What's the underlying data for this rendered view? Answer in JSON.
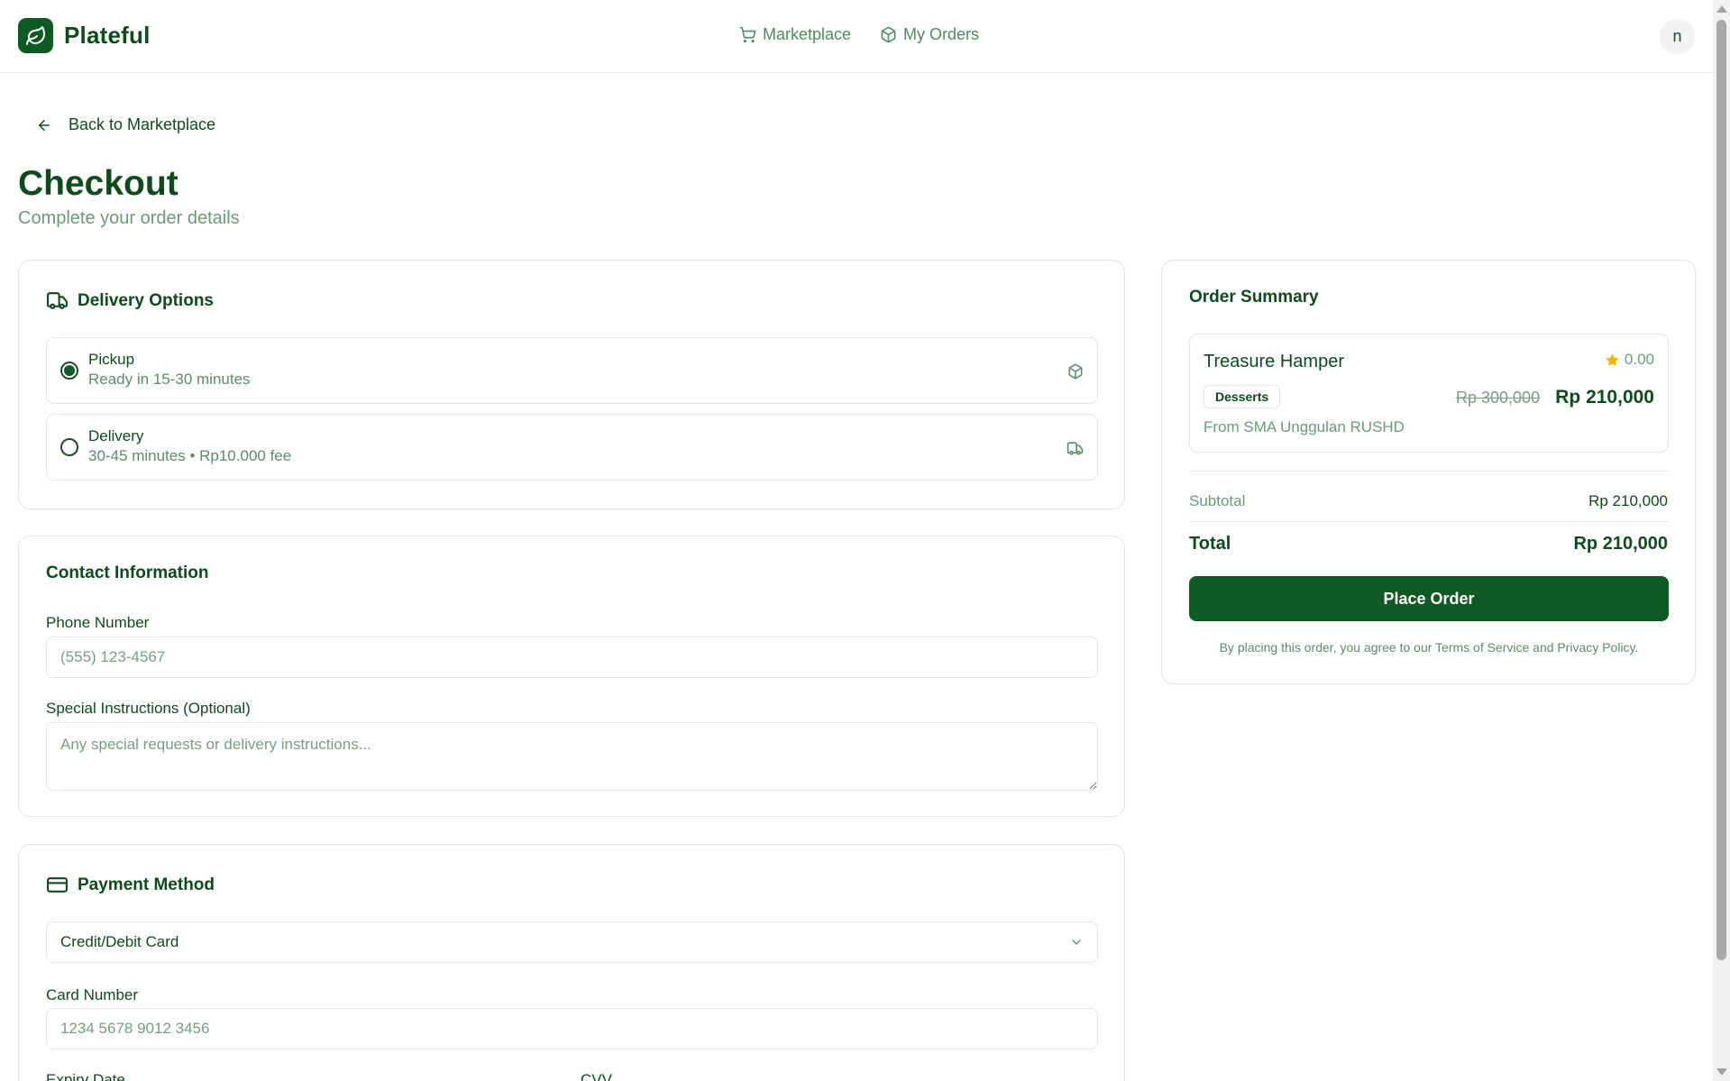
{
  "header": {
    "brand": "Plateful",
    "nav": [
      {
        "label": "Marketplace",
        "icon": "cart-icon"
      },
      {
        "label": "My Orders",
        "icon": "package-icon"
      }
    ],
    "avatar_initial": "n"
  },
  "back_label": "Back to Marketplace",
  "page": {
    "title": "Checkout",
    "subtitle": "Complete your order details"
  },
  "delivery": {
    "title": "Delivery Options",
    "selected": "Pickup",
    "options": [
      {
        "title": "Pickup",
        "subtitle": "Ready in 15-30 minutes",
        "icon": "package-icon"
      },
      {
        "title": "Delivery",
        "subtitle": "30-45 minutes • Rp10.000 fee",
        "icon": "truck-icon"
      }
    ]
  },
  "contact": {
    "title": "Contact Information",
    "phone_label": "Phone Number",
    "phone_placeholder": "(555) 123-4567",
    "phone_value": "",
    "instructions_label": "Special Instructions (Optional)",
    "instructions_placeholder": "Any special requests or delivery instructions...",
    "instructions_value": ""
  },
  "payment": {
    "title": "Payment Method",
    "method": "Credit/Debit Card",
    "card_label": "Card Number",
    "card_placeholder": "1234 5678 9012 3456",
    "expiry_label": "Expiry Date",
    "cvv_label": "CVV"
  },
  "summary": {
    "title": "Order Summary",
    "item": {
      "name": "Treasure Hamper",
      "rating": "0.00",
      "category": "Desserts",
      "original_price": "Rp 300,000",
      "price": "Rp 210,000",
      "source": "From SMA Unggulan RUSHD"
    },
    "subtotal_label": "Subtotal",
    "subtotal_value": "Rp 210,000",
    "total_label": "Total",
    "total_value": "Rp 210,000",
    "button": "Place Order",
    "terms": "By placing this order, you agree to our Terms of Service and Privacy Policy."
  },
  "colors": {
    "brand_green": "#0e5a22",
    "text_green": "#0f4a1d",
    "muted_green": "#6a9a78",
    "star": "#f5b400"
  }
}
